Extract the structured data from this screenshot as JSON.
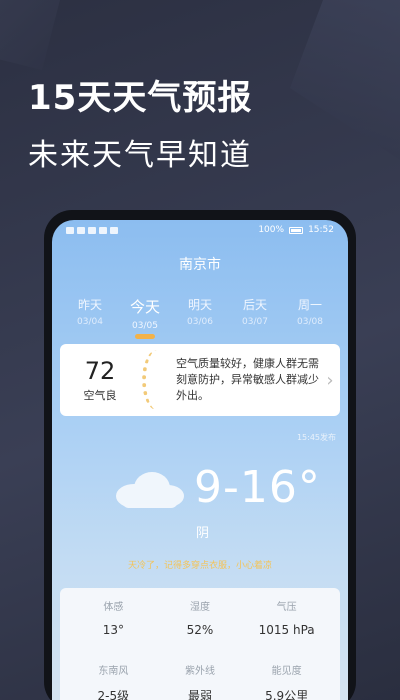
{
  "promo": {
    "title": "15天天气预报",
    "subtitle": "未来天气早知道"
  },
  "status_bar": {
    "battery": "100%",
    "time": "15:52"
  },
  "city": "南京市",
  "days": [
    {
      "name": "昨天",
      "date": "03/04"
    },
    {
      "name": "今天",
      "date": "03/05",
      "active": true
    },
    {
      "name": "明天",
      "date": "03/06"
    },
    {
      "name": "后天",
      "date": "03/07"
    },
    {
      "name": "周一",
      "date": "03/08"
    }
  ],
  "aqi": {
    "value": "72",
    "label": "空气良",
    "description": "空气质量较好，健康人群无需刻意防护，异常敏感人群减少外出。"
  },
  "publish_time": "15:45发布",
  "weather": {
    "temperature": "9-16°",
    "condition": "阴",
    "tip": "天冷了，记得多穿点衣服，小心着凉"
  },
  "details": [
    {
      "label": "体感",
      "value": "13°"
    },
    {
      "label": "湿度",
      "value": "52%"
    },
    {
      "label": "气压",
      "value": "1015 hPa"
    },
    {
      "label": "东南风",
      "value": "2-5级"
    },
    {
      "label": "紫外线",
      "value": "最弱"
    },
    {
      "label": "能见度",
      "value": "5.9公里"
    }
  ],
  "colors": {
    "accent": "#f2b24a",
    "tip": "#f3c45a",
    "sky_top": "#8cbdf0"
  }
}
